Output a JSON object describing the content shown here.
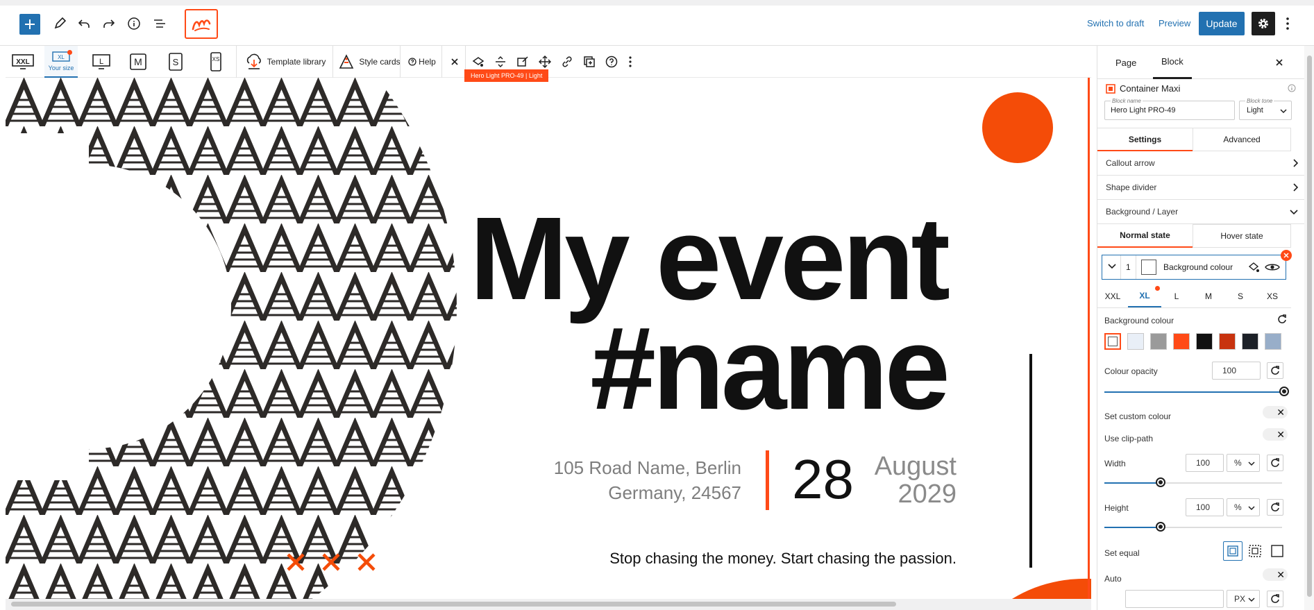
{
  "topbar": {
    "add_icon": "plus",
    "tools": [
      "pencil-icon",
      "undo-icon",
      "redo-icon",
      "info-icon",
      "list-view-icon"
    ],
    "switch_to_draft": "Switch to draft",
    "preview": "Preview",
    "update": "Update"
  },
  "maxi_toolbar": {
    "sizes": [
      {
        "label": "XXL",
        "sub": ""
      },
      {
        "label": "XL",
        "sub": "Your size"
      },
      {
        "label": "L",
        "sub": ""
      },
      {
        "label": "M",
        "sub": ""
      },
      {
        "label": "S",
        "sub": ""
      },
      {
        "label": "XS",
        "sub": ""
      }
    ],
    "template_library": "Template library",
    "style_cards": "Style cards",
    "help": "Help",
    "block_chip": "Hero Light PRO-49 | Light"
  },
  "hero": {
    "title_line1": "My event",
    "title_line2": "#name",
    "address_line1": "105 Road Name, Berlin",
    "address_line2": "Germany, 24567",
    "day": "28",
    "month": "August",
    "year": "2029",
    "tagline": "Stop chasing the money. Start chasing the passion.",
    "accent_color": "#f44c08"
  },
  "sidebar": {
    "tabs": [
      "Page",
      "Block"
    ],
    "active_tab": "Block",
    "block_title": "Container Maxi",
    "block_name_label": "Block name",
    "block_name_value": "Hero Light PRO-49",
    "block_tone_label": "Block tone",
    "block_tone_value": "Light",
    "settings_tab": "Settings",
    "advanced_tab": "Advanced",
    "panels": [
      "Callout arrow",
      "Shape divider",
      "Background / Layer"
    ],
    "state_tabs": [
      "Normal state",
      "Hover state"
    ],
    "layer_index": "1",
    "layer_label": "Background colour",
    "breakpoints": [
      "XXL",
      "XL",
      "L",
      "M",
      "S",
      "XS"
    ],
    "active_breakpoint": "XL",
    "bg_colour_label": "Background colour",
    "palette": [
      "#ffffff",
      "#e9eff7",
      "#9a9a9a",
      "#ff4a17",
      "#111111",
      "#c8330f",
      "#1c2027",
      "#98aec9"
    ],
    "colour_opacity_label": "Colour opacity",
    "colour_opacity_value": "100",
    "set_custom_colour": "Set custom colour",
    "use_clip_path": "Use clip-path",
    "width_label": "Width",
    "width_value": "100",
    "width_unit": "%",
    "height_label": "Height",
    "height_value": "100",
    "height_unit": "%",
    "set_equal": "Set equal",
    "auto": "Auto",
    "bottom_unit": "PX"
  }
}
